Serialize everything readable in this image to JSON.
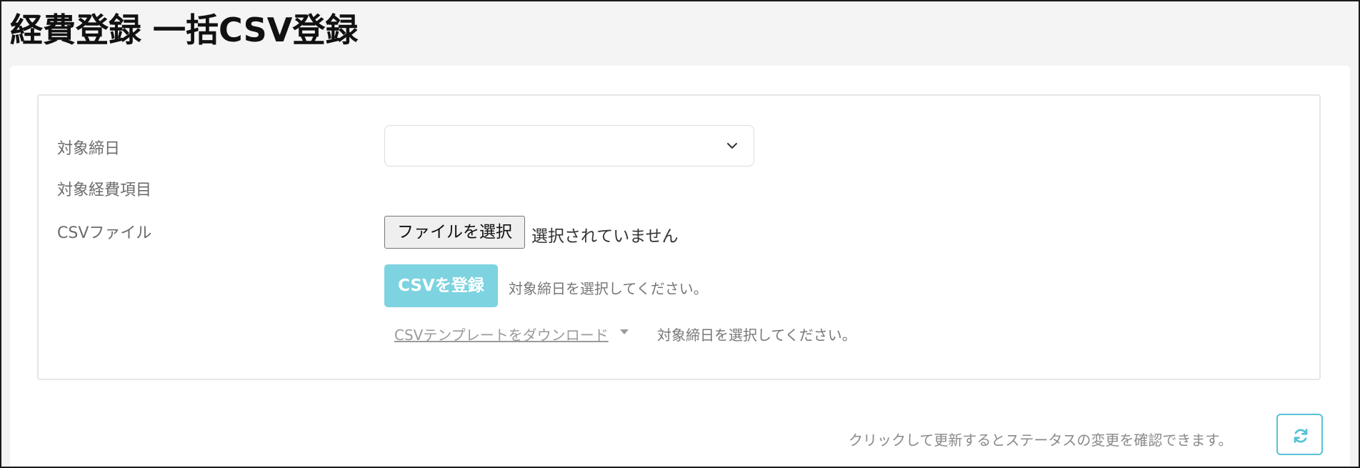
{
  "page": {
    "title": "経費登録 一括CSV登録"
  },
  "form": {
    "closing_date_label": "対象締日",
    "closing_date_value": "",
    "expense_item_label": "対象経費項目",
    "csv_file_label": "CSVファイル",
    "file_button_label": "ファイルを選択",
    "file_status": "選択されていません",
    "register_button_label": "CSVを登録",
    "register_hint": "対象締日を選択してください。",
    "template_link_label": "CSVテンプレートをダウンロード",
    "template_hint": "対象締日を選択してください。"
  },
  "footer": {
    "refresh_note": "クリックして更新するとステータスの変更を確認できます。"
  },
  "icons": {
    "select_chevron": "chevron-down-icon",
    "template_caret": "caret-down-icon",
    "refresh": "refresh-icon"
  },
  "colors": {
    "accent": "#56c2d6",
    "register_button_bg": "#7dd3e0",
    "page_bg": "#f4f4f4"
  }
}
